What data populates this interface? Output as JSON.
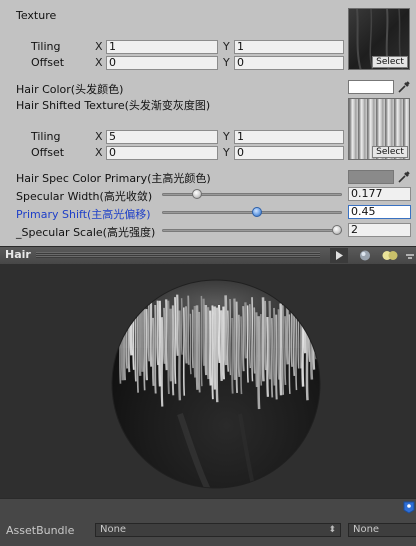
{
  "texture": {
    "label": "Texture",
    "tiling_label": "Tiling",
    "offset_label": "Offset",
    "tiling_x": "1",
    "tiling_y": "1",
    "offset_x": "0",
    "offset_y": "0",
    "select_label": "Select"
  },
  "hair_color": {
    "label": "Hair Color(头发颜色)",
    "color": "#ffffff"
  },
  "shift_texture": {
    "label": "Hair Shifted Texture(头发渐变灰度图)",
    "tiling_label": "Tiling",
    "offset_label": "Offset",
    "tiling_x": "5",
    "tiling_y": "1",
    "offset_x": "0",
    "offset_y": "0",
    "select_label": "Select"
  },
  "axis": {
    "x": "X",
    "y": "Y"
  },
  "spec_color": {
    "label": "Hair Spec Color Primary(主高光颜色)",
    "color": "#8a8a8a"
  },
  "specular_width": {
    "label": "Specular Width(高光收敛)",
    "value": "0.177",
    "fraction": 0.177
  },
  "primary_shift": {
    "label": "Primary Shift(主高光偏移)",
    "value": "0.45",
    "fraction": 0.53
  },
  "specular_scale": {
    "label": "_Specular Scale(高光强度)",
    "value": "2",
    "fraction": 1.0
  },
  "preview": {
    "title": "Hair"
  },
  "bottom": {
    "assetbundle_label": "AssetBundle",
    "bundle_value": "None",
    "variant_value": "None"
  },
  "colors": {
    "accent_label": "#1e3fc8",
    "panel_bg": "#c2c2c2",
    "preview_bg": "#2f2f2f"
  }
}
